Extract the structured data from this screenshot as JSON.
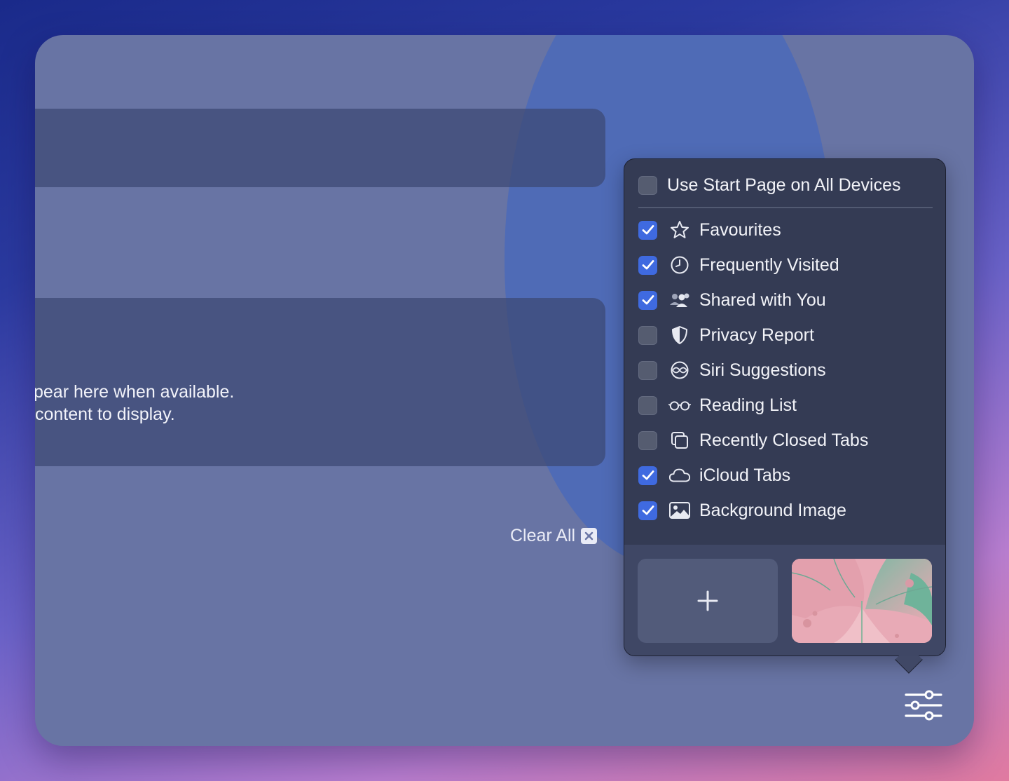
{
  "background_text": {
    "line1": "pear here when available.",
    "line2": " content to display."
  },
  "clear_all_label": "Clear All",
  "popover": {
    "sync_option": {
      "label": "Use Start Page on All Devices",
      "checked": false
    },
    "items": [
      {
        "label": "Favourites",
        "checked": true,
        "icon": "star-icon"
      },
      {
        "label": "Frequently Visited",
        "checked": true,
        "icon": "clock-icon"
      },
      {
        "label": "Shared with You",
        "checked": true,
        "icon": "people-icon"
      },
      {
        "label": "Privacy Report",
        "checked": false,
        "icon": "shield-icon"
      },
      {
        "label": "Siri Suggestions",
        "checked": false,
        "icon": "siri-icon"
      },
      {
        "label": "Reading List",
        "checked": false,
        "icon": "glasses-icon"
      },
      {
        "label": "Recently Closed Tabs",
        "checked": false,
        "icon": "tabs-icon"
      },
      {
        "label": "iCloud Tabs",
        "checked": true,
        "icon": "cloud-icon"
      },
      {
        "label": "Background Image",
        "checked": true,
        "icon": "image-icon"
      }
    ]
  },
  "colors": {
    "checkbox_on": "#3f6ae0",
    "popover_bg": "#343b54",
    "window_bg": "#6874a4"
  }
}
